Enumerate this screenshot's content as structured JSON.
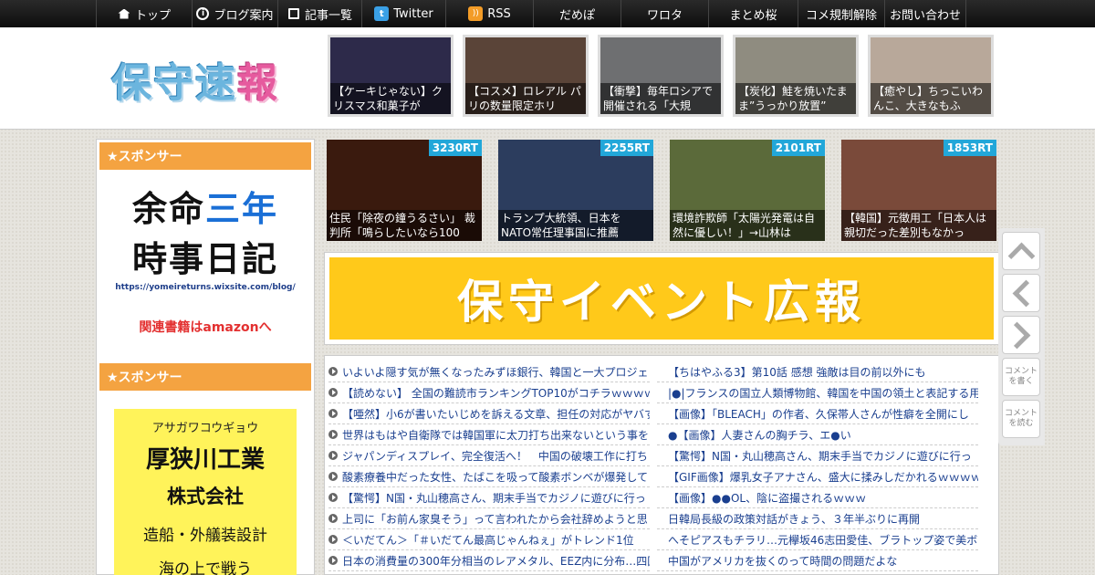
{
  "nav": {
    "items": [
      {
        "label": "トップ",
        "icon": "home-icon"
      },
      {
        "label": "ブログ案内",
        "icon": "info-icon"
      },
      {
        "label": "記事一覧",
        "icon": "list-icon"
      },
      {
        "label": "Twitter",
        "icon": "twitter-icon"
      },
      {
        "label": "RSS",
        "icon": "rss-icon"
      },
      {
        "label": "だめぽ",
        "icon": ""
      },
      {
        "label": "ワロタ",
        "icon": ""
      },
      {
        "label": "まとめ桜",
        "icon": ""
      },
      {
        "label": "コメ規制解除",
        "icon": ""
      },
      {
        "label": "お問い合わせ",
        "icon": ""
      }
    ]
  },
  "header": {
    "logo_blue": "保守速",
    "logo_pink": "報",
    "thumbs": [
      {
        "caption": "【ケーキじゃない】クリスマス和菓子が",
        "color": "#2d2a4a"
      },
      {
        "caption": "【コスメ】ロレアル パリの数量限定ホリ",
        "color": "#5a4438"
      },
      {
        "caption": "【衝撃】毎年ロシアで開催される「大規",
        "color": "#6e6f71"
      },
      {
        "caption": "【炭化】鮭を焼いたまま”うっかり放置”",
        "color": "#8f8c80"
      },
      {
        "caption": "【癒やし】ちっこいわんこ、大きなもふ",
        "color": "#b8a89a"
      }
    ]
  },
  "sidebar": {
    "sponsor_label": "★スポンサー",
    "ad1": {
      "line1a": "余命",
      "line1b": "三年",
      "line2": "時事日記",
      "url": "https://yomeireturns.wixsite.com/blog/",
      "amazon": "関連書籍はamazonへ"
    },
    "ad2": {
      "kana": "アサガワコウギョウ",
      "name": "厚狭川工業",
      "corp": "株式会社",
      "service": "造船・外艤装設計",
      "tagline": "海の上で戦う"
    }
  },
  "rt_items": [
    {
      "count": "3230RT",
      "caption": "住民「除夜の鐘うるさい」 裁判所「鳴らしたいなら100",
      "color": "#3a1a0e"
    },
    {
      "count": "2255RT",
      "caption": "トランプ大統領、日本をNATO常任理事国に推薦",
      "color": "#2c3d5e"
    },
    {
      "count": "2101RT",
      "caption": "環境詐欺師「太陽光発電は自然に優しい！」→山林は",
      "color": "#5b6a3a"
    },
    {
      "count": "1853RT",
      "caption": "【韓国】元徴用工「日本人は親切だった差別もなかっ",
      "color": "#7a4a3a"
    }
  ],
  "banner": {
    "text": "保守イベント広報"
  },
  "articles_left": [
    "いよいよ隠す気が無くなったみずほ銀行、韓国と一大プロジェ",
    "【読めない】 全国の難読市ランキングTOP10がコチラｗｗｗｗ",
    "【唖然】小6が書いたいじめを訴える文章、担任の対応がヤバす",
    "世界はもはや自衛隊では韓国軍に太刀打ち出来ないという事を",
    "ジャパンディスプレイ、完全復活へ！　中国の破壊工作に打ち",
    "酸素療養中だった女性、たばこを吸って酸素ボンベが爆発して",
    "【驚愕】N国・丸山穂高さん、期末手当でカジノに遊びに行っ",
    "上司に「お前ん家臭そう」って言われたから会社辞めようと思",
    "＜いだてん＞「＃いだてん最高じゃんねぇ」がトレンド1位",
    "日本の消費量の300年分相当のレアメタル、EEZ内に分布…四国"
  ],
  "articles_right": [
    "【ちはやふる3】第10話 感想 強敵は目の前以外にも",
    "|●|フランスの国立人類博物館、韓国を中国の領土と表記する用",
    "【画像】「BLEACH」の作者、久保帯人さんが性癖を全開にし",
    "●【画像】人妻さんの胸チラ、エ●い",
    "【驚愕】N国・丸山穂高さん、期末手当でカジノに遊びに行っ",
    "【GIF画像】爆乳女子アナさん、盛大に揉みしだかれるｗｗｗｗ",
    "【画像】●●OL、陰に盗撮されるｗｗｗ",
    "日韓局長級の政策対話がきょう、３年半ぶりに再開",
    "へそピアスもチラリ…元欅坂46志田愛佳、ブラトップ姿で美ボ",
    "中国がアメリカを抜くのって時間の問題だよな"
  ],
  "side_buttons": {
    "comment_write": "コメントを書く",
    "comment_read": "コメントを読む"
  }
}
